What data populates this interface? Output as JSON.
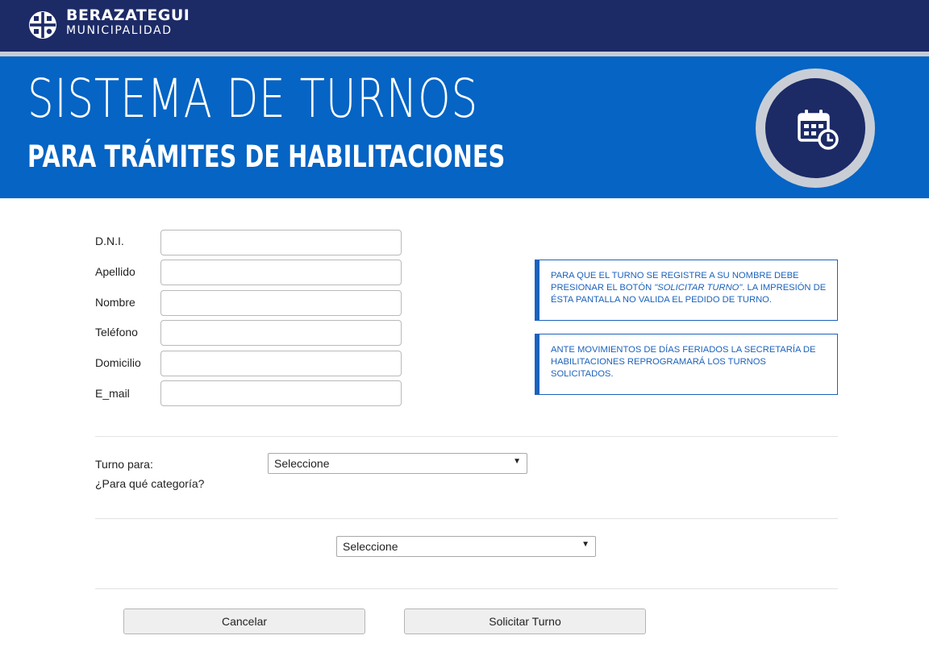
{
  "header": {
    "logo_title": "BERAZATEGUI",
    "logo_subtitle": "MUNICIPALIDAD"
  },
  "banner": {
    "title": "SISTEMA DE TURNOS",
    "subtitle": "PARA TRÁMITES DE HABILITACIONES",
    "icon": "calendar-clock-icon"
  },
  "form": {
    "fields": [
      {
        "label": "D.N.I.",
        "value": ""
      },
      {
        "label": "Apellido",
        "value": ""
      },
      {
        "label": "Nombre",
        "value": ""
      },
      {
        "label": "Teléfono",
        "value": ""
      },
      {
        "label": "Domicilio",
        "value": ""
      },
      {
        "label": "E_mail",
        "value": ""
      }
    ]
  },
  "notices": [
    {
      "before": "PARA QUE EL TURNO SE REGISTRE A SU NOMBRE DEBE PRESIONAR EL BOTÓN ",
      "emphasis": "\"SOLICITAR TURNO\"",
      "after": ". LA IMPRESIÓN DE ÉSTA PANTALLA NO VALIDA EL PEDIDO DE TURNO."
    },
    {
      "text": "ANTE MOVIMIENTOS DE DÍAS FERIADOS LA SECRETARÍA DE HABILITACIONES REPROGRAMARÁ LOS TURNOS SOLICITADOS."
    }
  ],
  "turno": {
    "label": "Turno para:",
    "sublabel": "¿Para qué categoría?",
    "select_value": "Seleccione",
    "second_select_value": "Seleccione"
  },
  "buttons": {
    "cancel": "Cancelar",
    "submit": "Solicitar Turno"
  },
  "colors": {
    "topbar": "#1c2a66",
    "banner": "#0564c4",
    "notice": "#1b62bd"
  }
}
